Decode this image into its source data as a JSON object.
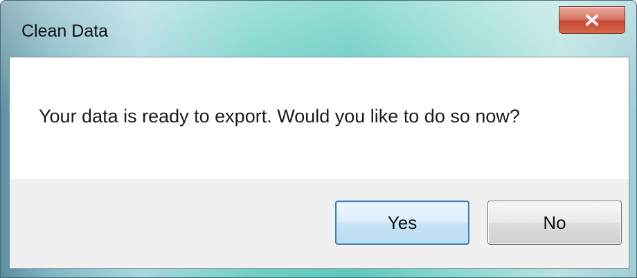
{
  "window": {
    "title": "Clean Data",
    "close_icon": "close-icon"
  },
  "dialog": {
    "message": "Your data is ready to export. Would you like to do so now?"
  },
  "buttons": {
    "yes_label": "Yes",
    "no_label": "No"
  },
  "colors": {
    "close_button": "#c74a33",
    "default_button_border": "#3c7fb1",
    "footer_background": "#f0f0f0"
  }
}
